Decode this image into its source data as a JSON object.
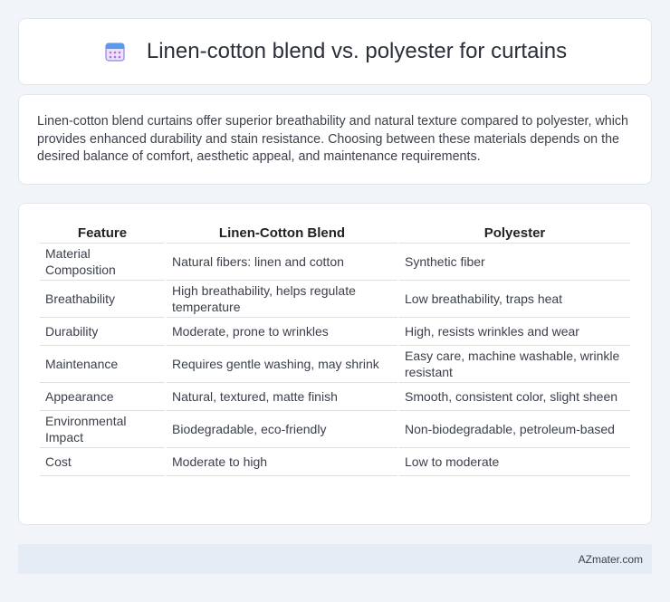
{
  "header": {
    "icon": "calendar-icon",
    "title": "Linen-cotton blend vs. polyester for curtains"
  },
  "intro": {
    "text": "Linen-cotton blend curtains offer superior breathability and natural texture compared to polyester, which provides enhanced durability and stain resistance. Choosing between these materials depends on the desired balance of comfort, aesthetic appeal, and maintenance requirements."
  },
  "table": {
    "headers": [
      "Feature",
      "Linen-Cotton Blend",
      "Polyester"
    ],
    "rows": [
      [
        "Material Composition",
        "Natural fibers: linen and cotton",
        "Synthetic fiber"
      ],
      [
        "Breathability",
        "High breathability, helps regulate temperature",
        "Low breathability, traps heat"
      ],
      [
        "Durability",
        "Moderate, prone to wrinkles",
        "High, resists wrinkles and wear"
      ],
      [
        "Maintenance",
        "Requires gentle washing, may shrink",
        "Easy care, machine washable, wrinkle resistant"
      ],
      [
        "Appearance",
        "Natural, textured, matte finish",
        "Smooth, consistent color, slight sheen"
      ],
      [
        "Environmental Impact",
        "Biodegradable, eco-friendly",
        "Non-biodegradable, petroleum-based"
      ],
      [
        "Cost",
        "Moderate to high",
        "Low to moderate"
      ]
    ]
  },
  "footer": {
    "brand": "AZmater.com"
  }
}
